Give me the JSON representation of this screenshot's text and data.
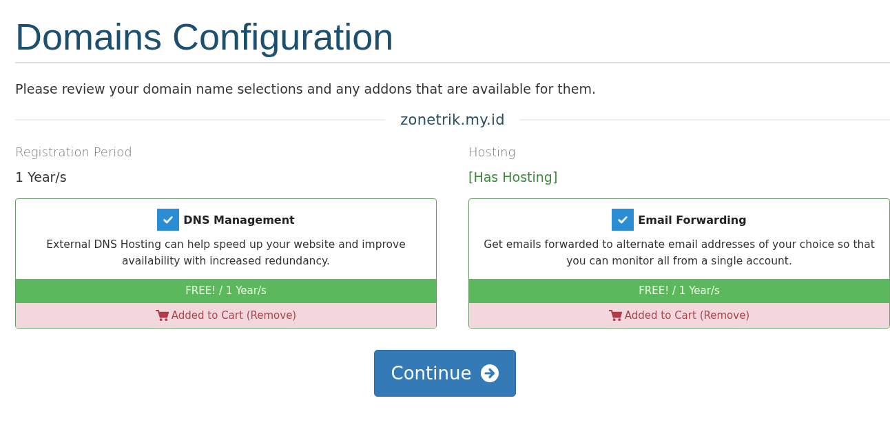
{
  "title": "Domains Configuration",
  "intro": "Please review your domain name selections and any addons that are available for them.",
  "domain": "zonetrik.my.id",
  "fields": [
    {
      "label": "Registration Period",
      "value": "1 Year/s",
      "kind": "plain"
    },
    {
      "label": "Hosting",
      "value": "[Has Hosting]",
      "kind": "status"
    }
  ],
  "addons": [
    {
      "name": "DNS Management",
      "checked": true,
      "description": "External DNS Hosting can help speed up your website and improve availability with increased redundancy.",
      "price": "FREE! / 1 Year/s",
      "cart": "Added to Cart (Remove)"
    },
    {
      "name": "Email Forwarding",
      "checked": true,
      "description": "Get emails forwarded to alternate email addresses of your choice so that you can monitor all from a single account.",
      "price": "FREE! / 1 Year/s",
      "cart": "Added to Cart (Remove)"
    }
  ],
  "continue_button": "Continue"
}
